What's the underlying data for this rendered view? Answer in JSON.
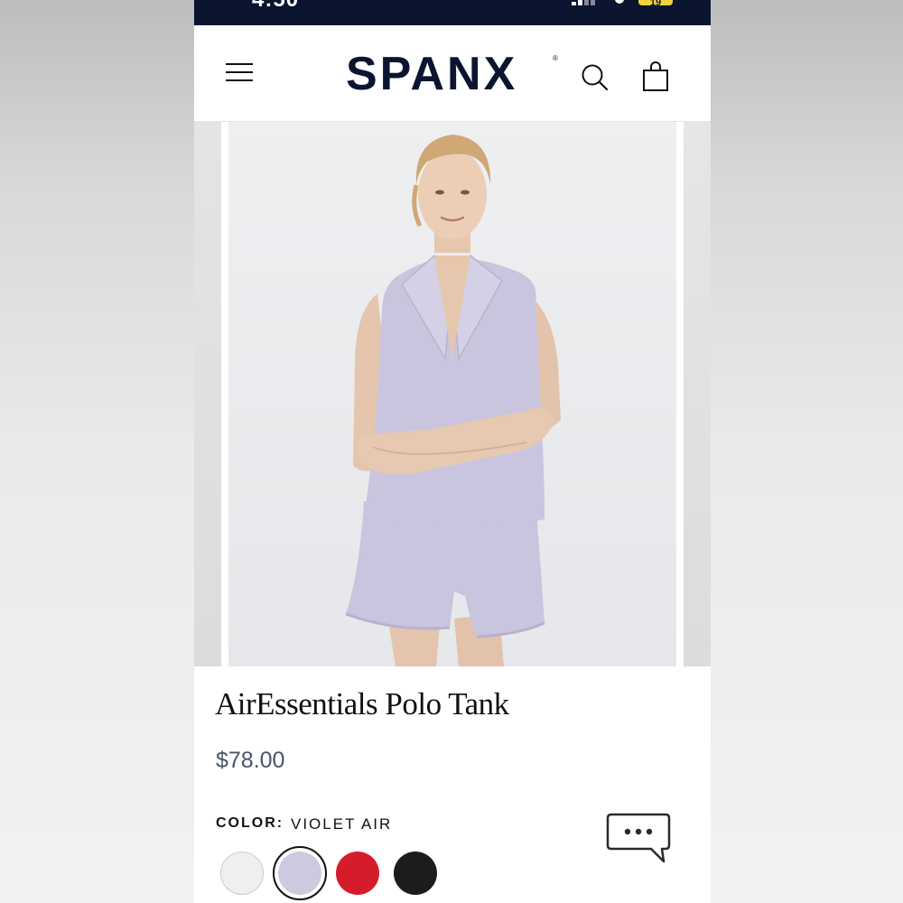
{
  "status_bar": {
    "time": "4:50",
    "battery": "19"
  },
  "header": {
    "brand": "SPANX",
    "brand_mark": "®",
    "icons": {
      "menu": "menu-icon",
      "search": "search-icon",
      "bag": "shopping-bag-icon"
    }
  },
  "product": {
    "title": "AirEssentials Polo Tank",
    "price": "$78.00",
    "color_label": "COLOR:",
    "color_value": "VIOLET AIR",
    "swatches": [
      {
        "name": "white",
        "color": "#eef0f0",
        "selected": false
      },
      {
        "name": "violet-air",
        "color": "#cdc9df",
        "selected": true
      },
      {
        "name": "red",
        "color": "#d51c2a",
        "selected": false
      },
      {
        "name": "black",
        "color": "#1c1c1e",
        "selected": false
      }
    ]
  },
  "colors": {
    "navy": "#0b1530",
    "price_gray": "#4b5368",
    "outfit_lavender": "#c9c5de"
  },
  "chat": {
    "icon": "chat-bubble-icon"
  }
}
